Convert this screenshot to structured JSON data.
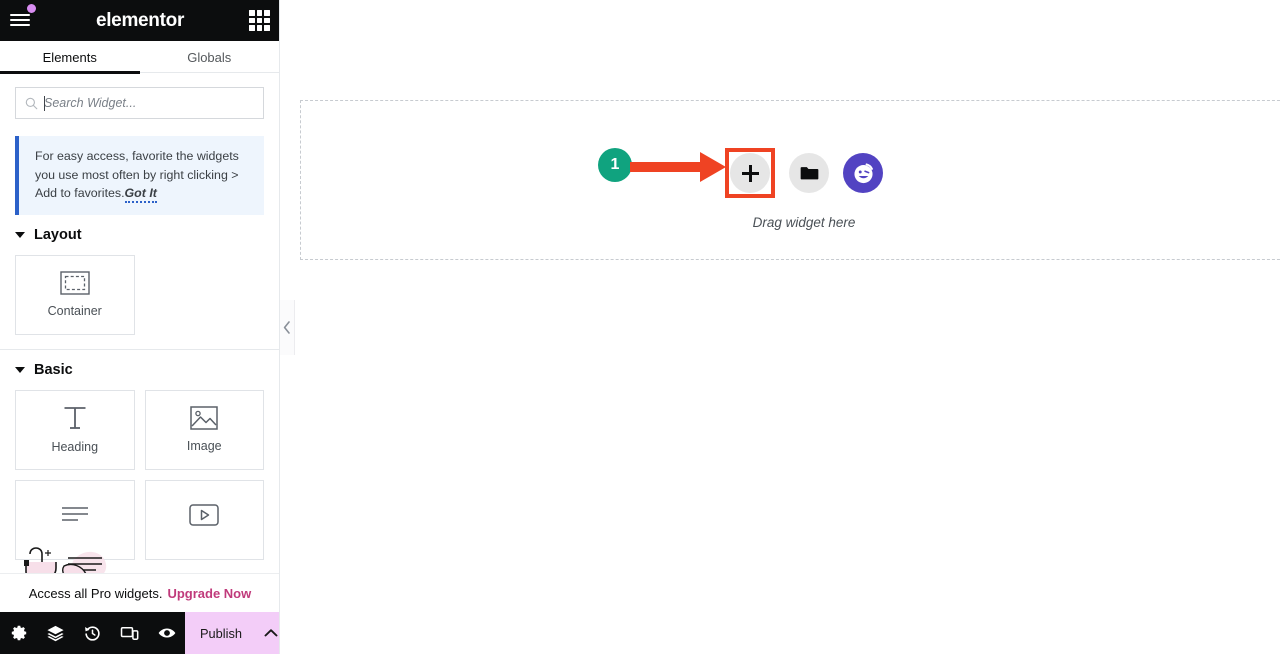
{
  "app": {
    "brand": "elementor",
    "hamburger_icon": "hamburger-menu-icon",
    "notification_dot": "notification-dot",
    "apps_grid_icon": "apps-grid-icon"
  },
  "panel": {
    "tabs": [
      {
        "label": "Elements",
        "active": true
      },
      {
        "label": "Globals",
        "active": false
      }
    ],
    "search": {
      "placeholder": "Search Widget...",
      "value": "",
      "icon": "search-icon"
    },
    "notice": {
      "text": "For easy access, favorite the widgets you use most often by right clicking > Add to favorites.",
      "cta": "Got It",
      "accent_color": "#2c61c9",
      "background_color": "#eef5fd"
    },
    "sections": [
      {
        "title": "Layout",
        "expanded": true,
        "widgets": [
          {
            "label": "Container",
            "icon": "container-icon"
          }
        ]
      },
      {
        "title": "Basic",
        "expanded": true,
        "widgets": [
          {
            "label": "Heading",
            "icon": "heading-icon"
          },
          {
            "label": "Image",
            "icon": "image-icon"
          },
          {
            "label": "",
            "icon": "text-editor-icon"
          },
          {
            "label": "",
            "icon": "video-icon"
          }
        ]
      }
    ],
    "pro_bar": {
      "text": "Access all Pro widgets.",
      "link": "Upgrade Now",
      "link_color": "#c03a7b"
    },
    "bottom_bar": {
      "tools": [
        {
          "name": "settings-icon",
          "title": "Settings"
        },
        {
          "name": "navigator-icon",
          "title": "Navigator"
        },
        {
          "name": "history-icon",
          "title": "History"
        },
        {
          "name": "responsive-icon",
          "title": "Responsive Mode"
        },
        {
          "name": "preview-icon",
          "title": "Preview Changes"
        }
      ],
      "publish_label": "Publish",
      "publish_caret_icon": "chevron-up-icon",
      "publish_color": "#f3cdf8"
    },
    "collapse_handle_icon": "chevron-left-icon"
  },
  "canvas": {
    "dropzone": {
      "label": "Drag widget here",
      "add_button": {
        "name": "add-element-button",
        "icon": "plus-icon",
        "highlighted": true
      },
      "folder_button": {
        "name": "add-template-button",
        "icon": "folder-icon"
      },
      "ai_button": {
        "name": "elementor-ai-button",
        "icon": "ai-face-icon",
        "color": "#5243c2"
      }
    }
  },
  "annotation": {
    "step_number": "1",
    "badge_color": "#10a37f",
    "arrow_color": "#ef4323",
    "highlight_color": "#ef4323"
  }
}
